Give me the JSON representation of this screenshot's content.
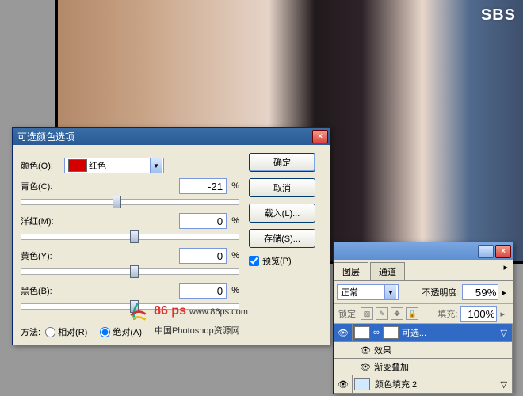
{
  "sbs_logo": "SBS",
  "watermark": {
    "brand": "86 ps",
    "url": "www.86ps.com",
    "sub": "中国Photoshop资源网"
  },
  "dialog": {
    "title": "可选颜色选项",
    "colors_label": "颜色(O):",
    "color_name": "红色",
    "color_hex": "#d40000",
    "sliders": {
      "cyan": {
        "label": "青色(C):",
        "value": "-21",
        "thumb": 42
      },
      "magenta": {
        "label": "洋红(M):",
        "value": "0",
        "thumb": 50
      },
      "yellow": {
        "label": "黄色(Y):",
        "value": "0",
        "thumb": 50
      },
      "black": {
        "label": "黑色(B):",
        "value": "0",
        "thumb": 50
      }
    },
    "buttons": {
      "ok": "确定",
      "cancel": "取消",
      "load": "载入(L)...",
      "save": "存储(S)..."
    },
    "preview": "预览(P)",
    "method": {
      "label": "方法:",
      "relative": "相对(R)",
      "absolute": "绝对(A)"
    }
  },
  "panel": {
    "tabs": {
      "layers": "图层",
      "channels": "通道"
    },
    "blend_mode": "正常",
    "opacity": {
      "label": "不透明度:",
      "value": "59%"
    },
    "lock": {
      "label": "锁定:",
      "fill_label": "填充:",
      "fill_value": "100%"
    },
    "layers": [
      {
        "name": "可选...",
        "selected": true,
        "kind": "adjust"
      },
      {
        "name": "效果",
        "sub": true
      },
      {
        "name": "渐变叠加",
        "sub": true
      },
      {
        "name": "颜色填充 2",
        "color": "#cfe9ff",
        "kind": "fill"
      }
    ]
  }
}
